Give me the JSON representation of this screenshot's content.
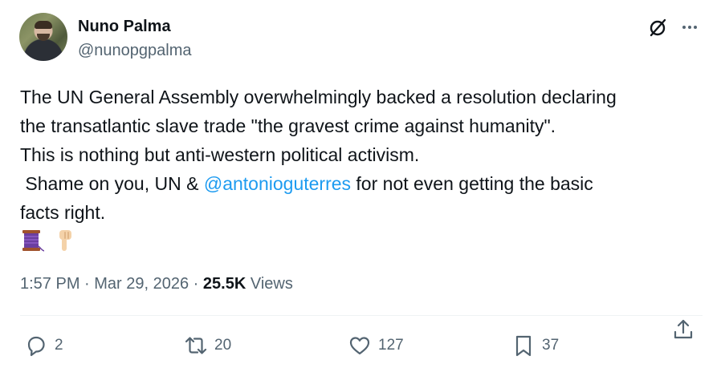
{
  "author": {
    "name": "Nuno Palma",
    "handle": "@nunopgpalma"
  },
  "header_icons": [
    "grok-icon",
    "more-icon"
  ],
  "tweet": {
    "line1": "The UN General Assembly overwhelmingly backed a resolution declaring",
    "line2": "the transatlantic slave trade \"the gravest crime against humanity\".",
    "line3": "This is nothing but anti-western political activism.",
    "line4_before": " Shame on you, UN & ",
    "mention": "@antonioguterres",
    "line4_after": " for not even getting the basic",
    "line5": "facts right.",
    "emojis": [
      "thread-spool-emoji",
      "pointing-down-emoji"
    ]
  },
  "meta": {
    "time": "1:57 PM",
    "separator1": " · ",
    "date": "Mar 29, 2026",
    "separator2": " · ",
    "views_count": "25.5K",
    "views_label": " Views"
  },
  "actions": {
    "replies": "2",
    "reposts": "20",
    "likes": "127",
    "bookmarks": "37"
  },
  "colors": {
    "text": "#0f1419",
    "secondary": "#536471",
    "link": "#1d9bf0",
    "divider": "#eff3f4"
  }
}
